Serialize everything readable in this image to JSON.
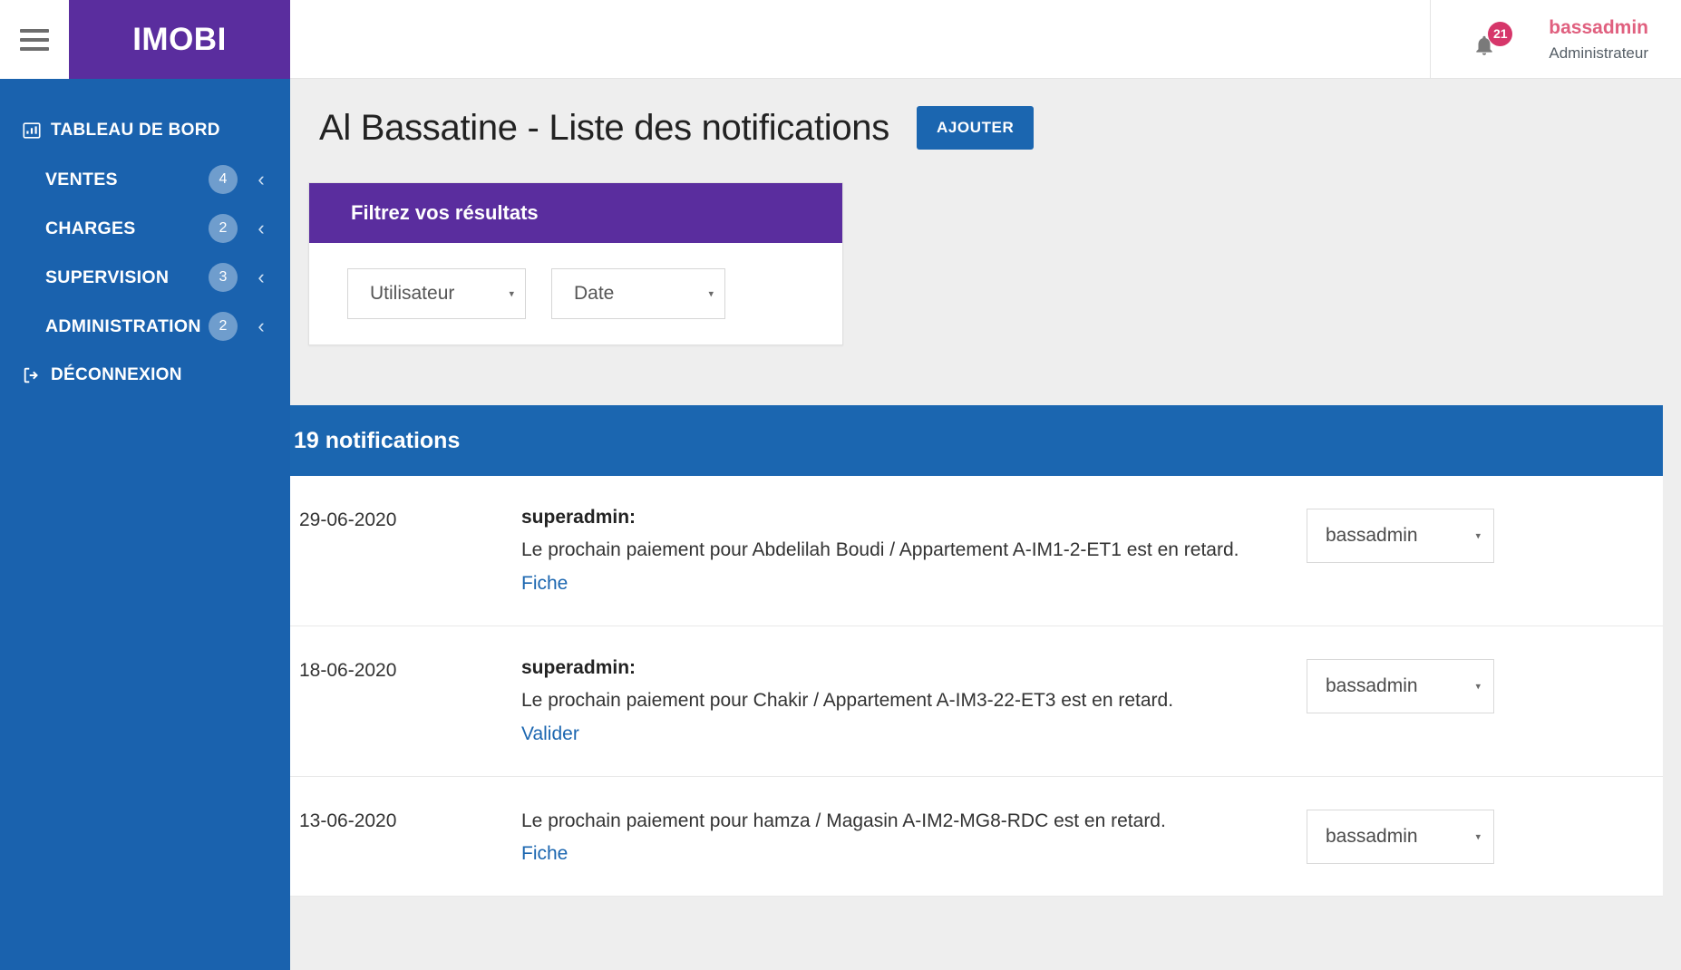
{
  "topbar": {
    "menu_icon": "hamburger-icon",
    "logo": "IMOBI",
    "bell_icon": "bell-icon",
    "notification_count": "21",
    "user_name": "bassadmin",
    "user_role": "Administrateur",
    "accent_purple": "#5a2d9e",
    "accent_pink": "#d6366a"
  },
  "sidebar": {
    "bg": "#1a62ae",
    "items": [
      {
        "label": "TABLEAU DE BORD",
        "icon": "dashboard-chart-icon",
        "badge": "",
        "chevron": "",
        "sub": false
      },
      {
        "label": "VENTES",
        "icon": "",
        "badge": "4",
        "chevron": "‹",
        "sub": true
      },
      {
        "label": "CHARGES",
        "icon": "",
        "badge": "2",
        "chevron": "‹",
        "sub": true
      },
      {
        "label": "SUPERVISION",
        "icon": "",
        "badge": "3",
        "chevron": "‹",
        "sub": true
      },
      {
        "label": "ADMINISTRATION",
        "icon": "",
        "badge": "2",
        "chevron": "‹",
        "sub": true
      },
      {
        "label": "DÉCONNEXION",
        "icon": "logout-icon",
        "badge": "",
        "chevron": "",
        "sub": false
      }
    ]
  },
  "page": {
    "title": "Al Bassatine - Liste des notifications",
    "add_button": "AJOUTER"
  },
  "filter": {
    "heading": "Filtrez vos résultats",
    "user_select": {
      "value": "Utilisateur",
      "caret": "▾"
    },
    "date_select": {
      "value": "Date",
      "caret": "▾"
    }
  },
  "list": {
    "header": "19 notifications",
    "header_bg": "#1b66b0",
    "rows": [
      {
        "date": "29-06-2020",
        "user": "superadmin:",
        "text": "Le prochain paiement pour Abdelilah Boudi / Appartement A-IM1-2-ET1 est en retard.",
        "link": "Fiche",
        "select_value": "bassadmin",
        "caret": "▾"
      },
      {
        "date": "18-06-2020",
        "user": "superadmin:",
        "text": "Le prochain paiement pour Chakir / Appartement A-IM3-22-ET3 est en retard.",
        "link": "Valider",
        "select_value": "bassadmin",
        "caret": "▾"
      },
      {
        "date": "13-06-2020",
        "user": "",
        "text": "Le prochain paiement pour hamza / Magasin A-IM2-MG8-RDC est en retard.",
        "link": "Fiche",
        "select_value": "bassadmin",
        "caret": "▾"
      }
    ]
  }
}
